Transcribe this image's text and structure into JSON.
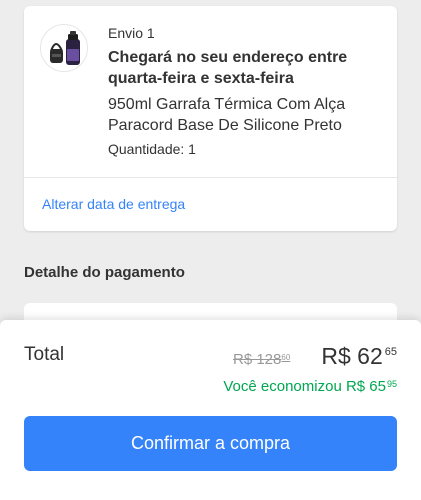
{
  "shipment": {
    "label": "Envio 1",
    "delivery_estimate": "Chegará no seu endereço entre quarta-feira e sexta-feira",
    "product_name": "950ml Garrafa Térmica Com Alça Paracord Base De Silicone Preto",
    "quantity": "Quantidade: 1",
    "change_date_link": "Alterar data de entrega"
  },
  "payment": {
    "heading": "Detalhe do pagamento"
  },
  "summary": {
    "total_label": "Total",
    "old_price_main": "R$ 128",
    "old_price_cents": "60",
    "new_price_main": "R$ 62",
    "new_price_cents": "65",
    "savings_main": "Você economizou R$ 65",
    "savings_cents": "95",
    "confirm_button": "Confirmar a compra"
  },
  "colors": {
    "accent": "#3483fa",
    "savings": "#00a650",
    "background": "#ededed"
  }
}
